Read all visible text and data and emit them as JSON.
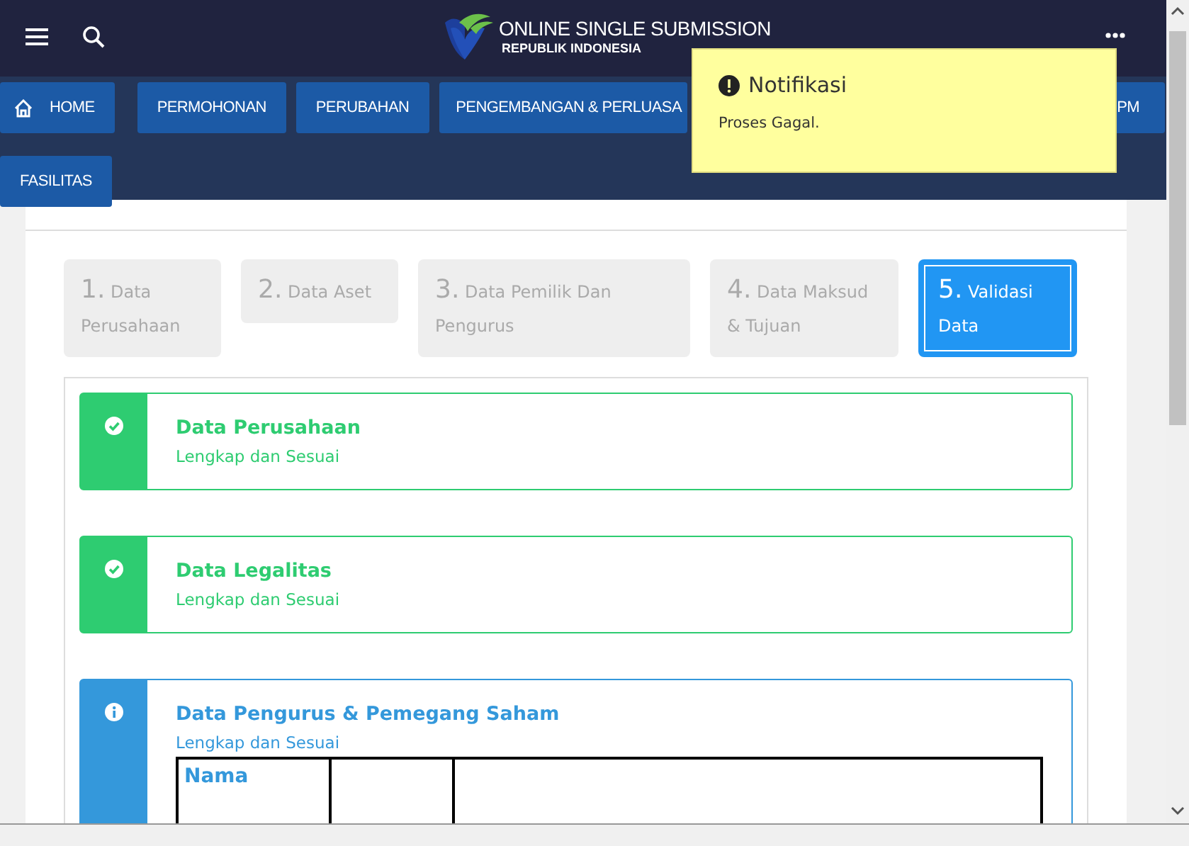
{
  "header": {
    "title": "ONLINE SINGLE SUBMISSION",
    "subtitle": "REPUBLIK INDONESIA"
  },
  "nav": [
    {
      "label": "HOME",
      "kind": "home"
    },
    {
      "label": "PERMOHONAN",
      "kind": "plain"
    },
    {
      "label": "PERUBAHAN",
      "kind": "plain"
    },
    {
      "label": "PENGEMBANGAN & PERLUASA",
      "kind": "plain"
    },
    {
      "label": "PM",
      "kind": "covered"
    },
    {
      "label": "FASILITAS",
      "kind": "plain"
    }
  ],
  "steps": [
    {
      "number": "1.",
      "label": "Data Perusahaan",
      "selected": false
    },
    {
      "number": "2.",
      "label": "Data Aset",
      "selected": false
    },
    {
      "number": "3.",
      "label": "Data Pemilik Dan Pengurus",
      "selected": false
    },
    {
      "number": "4.",
      "label": "Data Maksud & Tujuan",
      "selected": false
    },
    {
      "number": "5.",
      "label": "Validasi Data",
      "selected": true
    }
  ],
  "sections": [
    {
      "title": "Data Perusahaan",
      "status": "Lengkap dan Sesuai",
      "kind": "complete"
    },
    {
      "title": "Data Legalitas",
      "status": "Lengkap dan Sesuai",
      "kind": "complete"
    },
    {
      "title": "Data Pengurus & Pemegang Saham",
      "status": "Lengkap dan Sesuai",
      "kind": "info",
      "table": {
        "columns": [
          "Nama"
        ]
      }
    }
  ],
  "notification": {
    "title": "Notifikasi",
    "message": "Proses Gagal."
  }
}
